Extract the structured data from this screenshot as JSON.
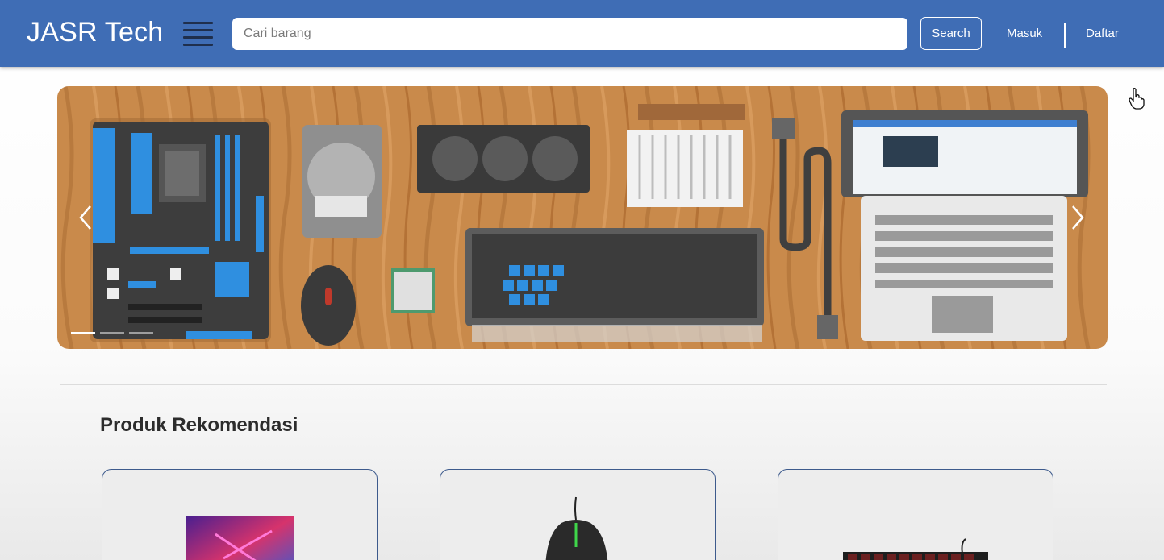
{
  "navbar": {
    "brand": "JASR Tech",
    "search_placeholder": "Cari barang",
    "search_button": "Search",
    "login": "Masuk",
    "register": "Daftar"
  },
  "carousel": {
    "slide_count": 3,
    "active_index": 0
  },
  "recommendations": {
    "title": "Produk Rekomendasi",
    "products": [
      {
        "icon": "gaming-laptop-image"
      },
      {
        "icon": "gaming-mouse-image"
      },
      {
        "icon": "mechanical-keyboard-image"
      }
    ]
  },
  "colors": {
    "navbar": "#3f6db5",
    "card_border": "#3d5a8c",
    "wood": "#c98a4b"
  }
}
